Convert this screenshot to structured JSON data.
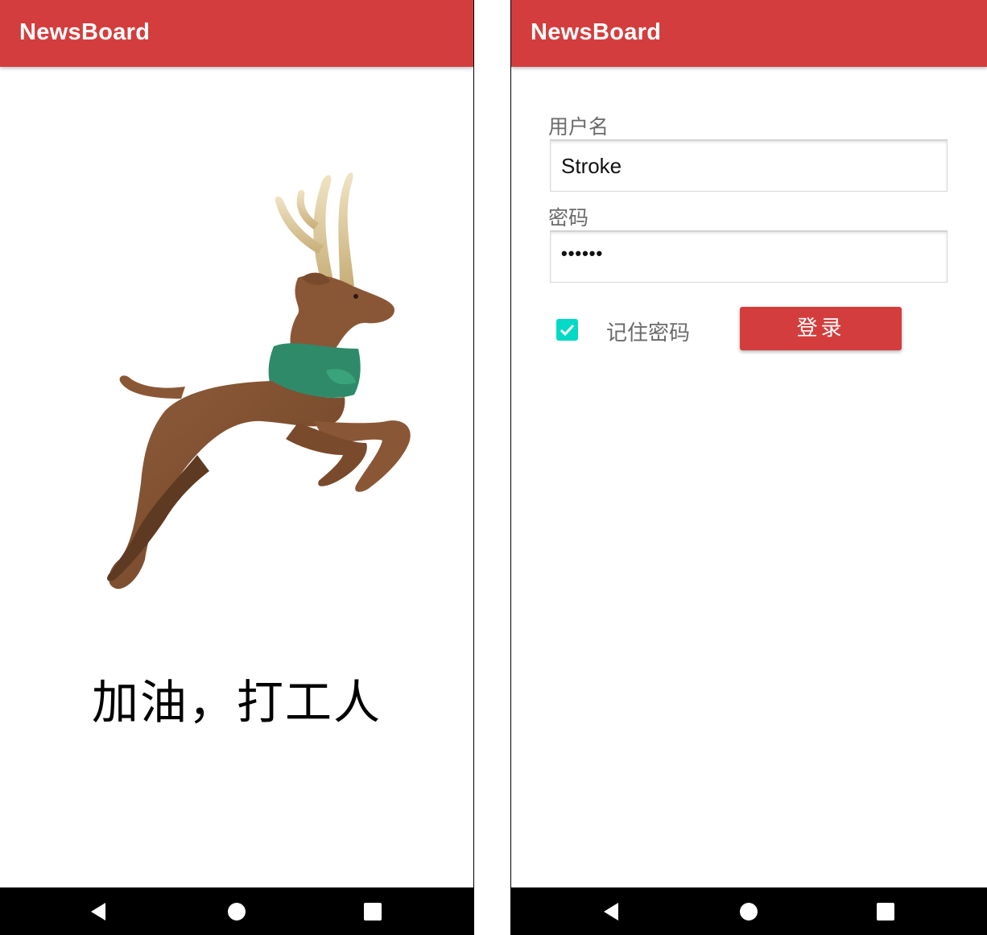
{
  "colors": {
    "app_bar": "#d43d3d",
    "accent": "#03dac5",
    "button": "#d43d3d",
    "nav_bar": "#000000"
  },
  "splash": {
    "app_title": "NewsBoard",
    "image": "reindeer-illustration",
    "slogan": "加油，打工人",
    "nav": {
      "back_icon": "back-triangle-icon",
      "home_icon": "home-circle-icon",
      "recents_icon": "recents-square-icon"
    }
  },
  "login": {
    "app_title": "NewsBoard",
    "username_label": "用户名",
    "username_value": "Stroke",
    "password_label": "密码",
    "password_value": "••••••",
    "remember_checked": true,
    "remember_label": "记住密码",
    "login_button": "登录",
    "nav": {
      "back_icon": "back-triangle-icon",
      "home_icon": "home-circle-icon",
      "recents_icon": "recents-square-icon"
    }
  }
}
